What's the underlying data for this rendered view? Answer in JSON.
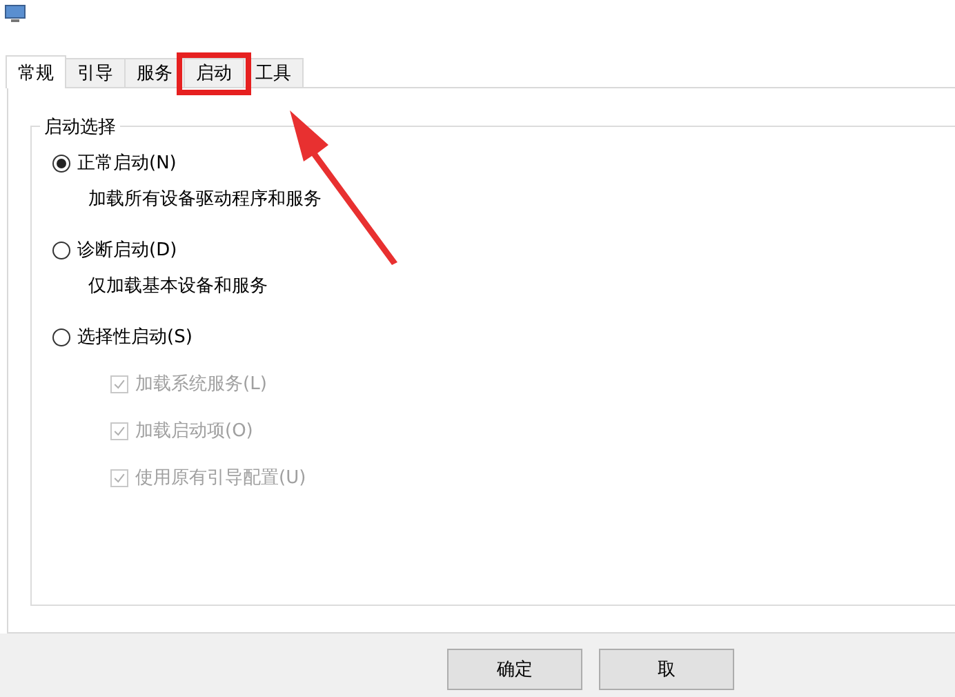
{
  "tabs": [
    {
      "label": "常规",
      "selected": true,
      "highlighted": false
    },
    {
      "label": "引导",
      "selected": false,
      "highlighted": false
    },
    {
      "label": "服务",
      "selected": false,
      "highlighted": false
    },
    {
      "label": "启动",
      "selected": false,
      "highlighted": true
    },
    {
      "label": "工具",
      "selected": false,
      "highlighted": false
    }
  ],
  "group": {
    "title": "启动选择",
    "options": [
      {
        "kind": "radio",
        "label": "正常启动(N)",
        "selected": true,
        "description": "加载所有设备驱动程序和服务"
      },
      {
        "kind": "radio",
        "label": "诊断启动(D)",
        "selected": false,
        "description": "仅加载基本设备和服务"
      },
      {
        "kind": "radio",
        "label": "选择性启动(S)",
        "selected": false
      },
      {
        "kind": "checkbox",
        "label": "加载系统服务(L)",
        "checked": true,
        "disabled": true
      },
      {
        "kind": "checkbox",
        "label": "加载启动项(O)",
        "checked": true,
        "disabled": true
      },
      {
        "kind": "checkbox",
        "label": "使用原有引导配置(U)",
        "checked": true,
        "disabled": true
      }
    ]
  },
  "buttons": [
    "确定",
    "取"
  ]
}
